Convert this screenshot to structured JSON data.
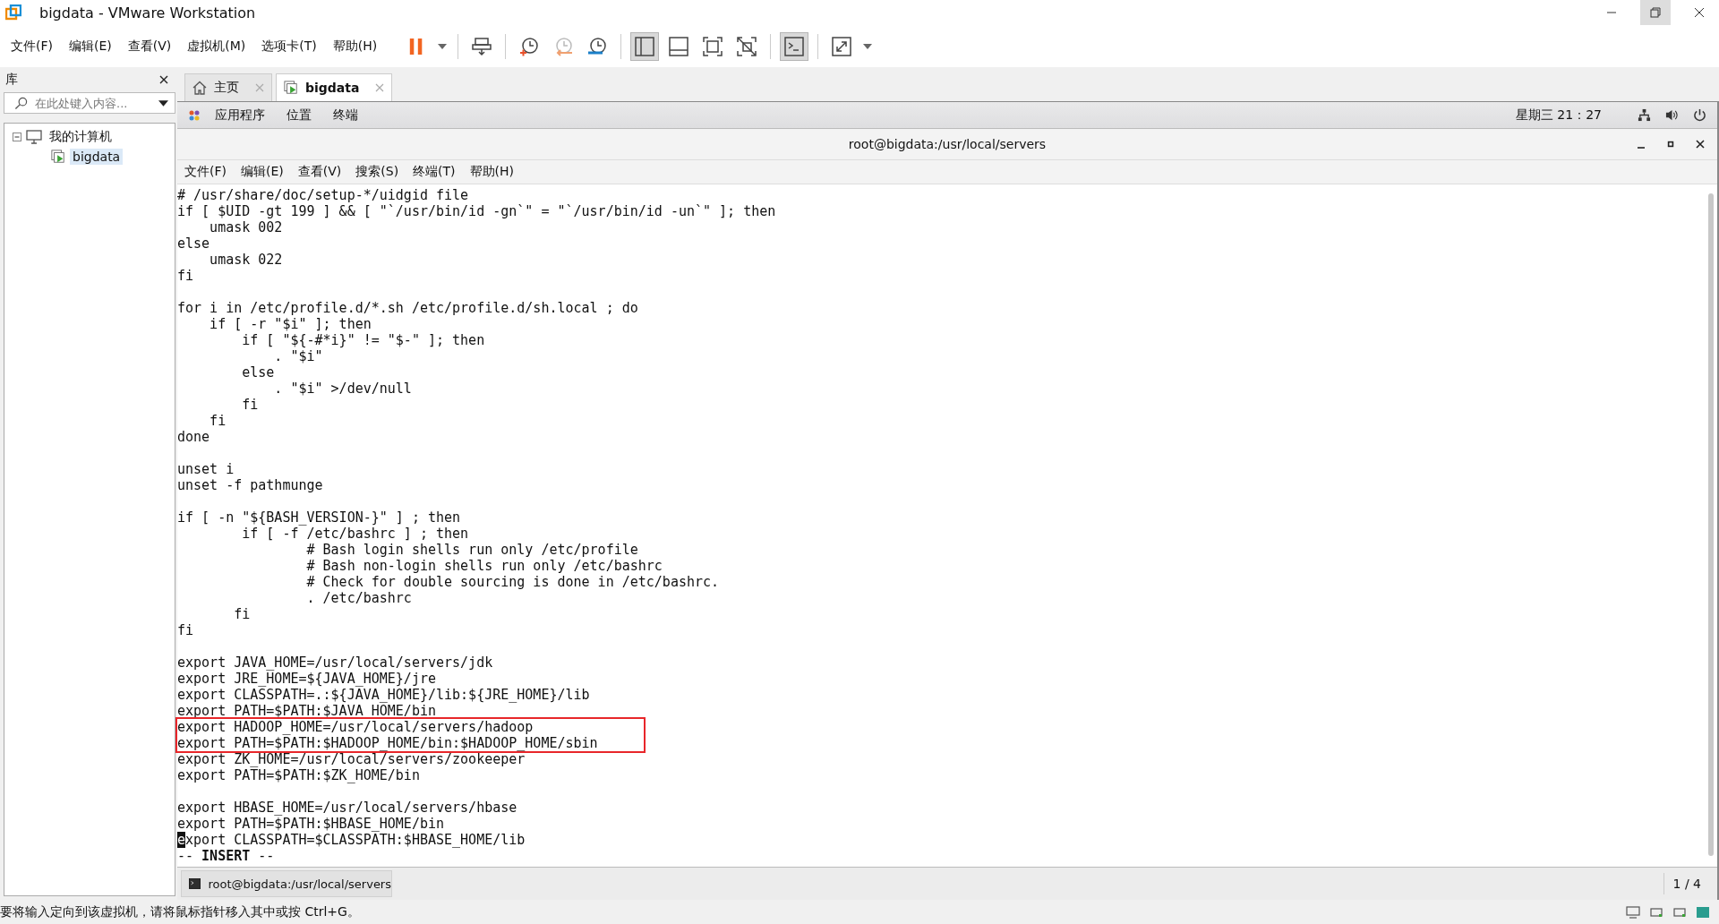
{
  "window": {
    "title": "bigdata - VMware Workstation"
  },
  "menu": [
    "文件(F)",
    "编辑(E)",
    "查看(V)",
    "虚拟机(M)",
    "选项卡(T)",
    "帮助(H)"
  ],
  "toolbar": [
    {
      "items": [
        {
          "kind": "pause"
        },
        {
          "kind": "dropdown"
        }
      ]
    },
    {
      "items": [
        {
          "kind": "send-keys"
        }
      ]
    },
    {
      "items": [
        {
          "kind": "snapshot-take"
        },
        {
          "kind": "snapshot-revert"
        },
        {
          "kind": "snapshot-manage"
        }
      ]
    },
    {
      "items": [
        {
          "kind": "view-library",
          "selected": true
        },
        {
          "kind": "view-thumbnail",
          "selected": false
        },
        {
          "kind": "view-fit",
          "selected": false
        },
        {
          "kind": "view-unity",
          "selected": false
        }
      ]
    },
    {
      "items": [
        {
          "kind": "console",
          "selected": true
        }
      ]
    },
    {
      "items": [
        {
          "kind": "fullscreen"
        },
        {
          "kind": "dropdown"
        }
      ]
    }
  ],
  "library": {
    "title": "库",
    "search": {
      "placeholder": "在此处键入内容..."
    },
    "tree": [
      {
        "label": "我的计算机",
        "kind": "computer",
        "expanded": true,
        "selected": false,
        "children": [
          {
            "label": "bigdata",
            "kind": "vm",
            "selected": true
          }
        ]
      }
    ]
  },
  "tabs": [
    {
      "label": "主页",
      "kind": "home",
      "selected": false
    },
    {
      "label": "bigdata",
      "kind": "vm",
      "selected": true
    }
  ],
  "guest_top_bar": {
    "menus": [
      "应用程序",
      "位置",
      "终端"
    ],
    "clock": "星期三 21：27"
  },
  "terminal": {
    "title": "root@bigdata:/usr/local/servers",
    "menu": [
      "文件(F)",
      "编辑(E)",
      "查看(V)",
      "搜索(S)",
      "终端(T)",
      "帮助(H)"
    ],
    "blocks": [
      [
        {
          "highlighted": false,
          "cursor": false,
          "lines": [
            "# /usr/share/doc/setup-*/uidgid file",
            "if [ $UID -gt 199 ] && [ \"`/usr/bin/id -gn`\" = \"`/usr/bin/id -un`\" ]; then",
            "    umask 002",
            "else",
            "    umask 022",
            "fi"
          ]
        }
      ],
      [
        {
          "highlighted": false,
          "cursor": false,
          "lines": [
            "for i in /etc/profile.d/*.sh /etc/profile.d/sh.local ; do",
            "    if [ -r \"$i\" ]; then",
            "        if [ \"${-#*i}\" != \"$-\" ]; then",
            "            . \"$i\"",
            "        else",
            "            . \"$i\" >/dev/null",
            "        fi",
            "    fi",
            "done"
          ]
        }
      ],
      [
        {
          "highlighted": false,
          "cursor": false,
          "lines": [
            "unset i",
            "unset -f pathmunge"
          ]
        }
      ],
      [
        {
          "highlighted": false,
          "cursor": false,
          "lines": [
            "if [ -n \"${BASH_VERSION-}\" ] ; then",
            "        if [ -f /etc/bashrc ] ; then",
            "                # Bash login shells run only /etc/profile",
            "                # Bash non-login shells run only /etc/bashrc",
            "                # Check for double sourcing is done in /etc/bashrc.",
            "                . /etc/bashrc",
            "       fi",
            "fi"
          ]
        }
      ],
      [
        {
          "highlighted": false,
          "cursor": false,
          "lines": [
            "export JAVA_HOME=/usr/local/servers/jdk",
            "export JRE_HOME=${JAVA_HOME}/jre",
            "export CLASSPATH=.:${JAVA_HOME}/lib:${JRE_HOME}/lib",
            "export PATH=$PATH:$JAVA_HOME/bin"
          ]
        },
        {
          "highlighted": true,
          "cursor": false,
          "lines": [
            "export HADOOP_HOME=/usr/local/servers/hadoop",
            "export PATH=$PATH:$HADOOP_HOME/bin:$HADOOP_HOME/sbin"
          ]
        },
        {
          "highlighted": false,
          "cursor": false,
          "lines": [
            "export ZK_HOME=/usr/local/servers/zookeeper",
            "export PATH=$PATH:$ZK_HOME/bin"
          ]
        }
      ],
      [
        {
          "highlighted": false,
          "cursor": false,
          "lines": [
            "export HBASE_HOME=/usr/local/servers/hbase",
            "export PATH=$PATH:$HBASE_HOME/bin"
          ]
        },
        {
          "highlighted": false,
          "cursor": true,
          "lines": [
            "export CLASSPATH=$CLASSPATH:$HBASE_HOME/lib"
          ]
        }
      ]
    ],
    "mode_line": "-- **INSERT** --"
  },
  "guest_taskbar": {
    "window": "root@bigdata:/usr/local/servers",
    "pager": "1 / 4"
  },
  "status_bar": {
    "message": "要将输入定向到该虚拟机，请将鼠标指针移入其中或按 Ctrl+G。"
  }
}
